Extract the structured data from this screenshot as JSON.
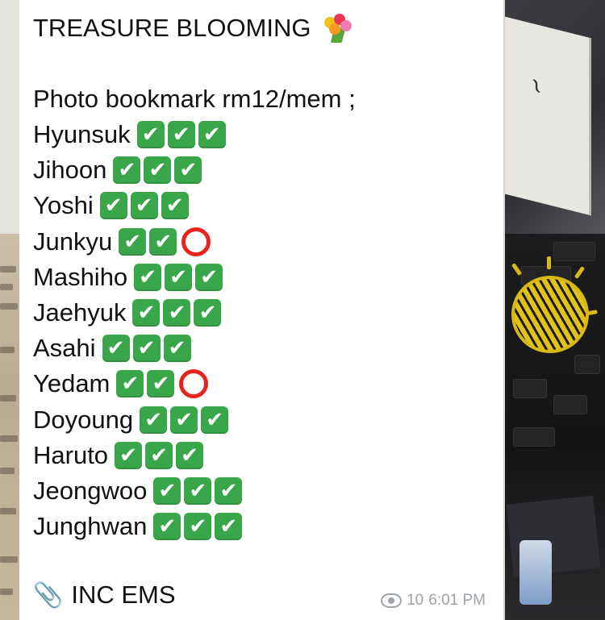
{
  "message": {
    "title": "TREASURE BLOOMING",
    "title_emoji": "bouquet-icon",
    "subtitle": "Photo bookmark rm12/mem ;",
    "members": [
      {
        "name": "Hyunsuk",
        "status": [
          "check",
          "check",
          "check"
        ]
      },
      {
        "name": "Jihoon",
        "status": [
          "check",
          "check",
          "check"
        ]
      },
      {
        "name": "Yoshi",
        "status": [
          "check",
          "check",
          "check"
        ]
      },
      {
        "name": "Junkyu",
        "status": [
          "check",
          "check",
          "circle"
        ]
      },
      {
        "name": "Mashiho",
        "status": [
          "check",
          "check",
          "check"
        ]
      },
      {
        "name": "Jaehyuk",
        "status": [
          "check",
          "check",
          "check"
        ]
      },
      {
        "name": "Asahi",
        "status": [
          "check",
          "check",
          "check"
        ]
      },
      {
        "name": "Yedam",
        "status": [
          "check",
          "check",
          "circle"
        ]
      },
      {
        "name": "Doyoung",
        "status": [
          "check",
          "check",
          "check"
        ]
      },
      {
        "name": "Haruto",
        "status": [
          "check",
          "check",
          "check"
        ]
      },
      {
        "name": "Jeongwoo",
        "status": [
          "check",
          "check",
          "check"
        ]
      },
      {
        "name": "Junghwan",
        "status": [
          "check",
          "check",
          "check"
        ]
      }
    ],
    "footer_text": "INC EMS",
    "footer_icon": "paperclip-icon",
    "views": "10",
    "time": "6:01 PM"
  },
  "colors": {
    "check_green": "#3aa64a",
    "circle_red": "#e8241f",
    "meta_gray": "#9ea3aa"
  }
}
